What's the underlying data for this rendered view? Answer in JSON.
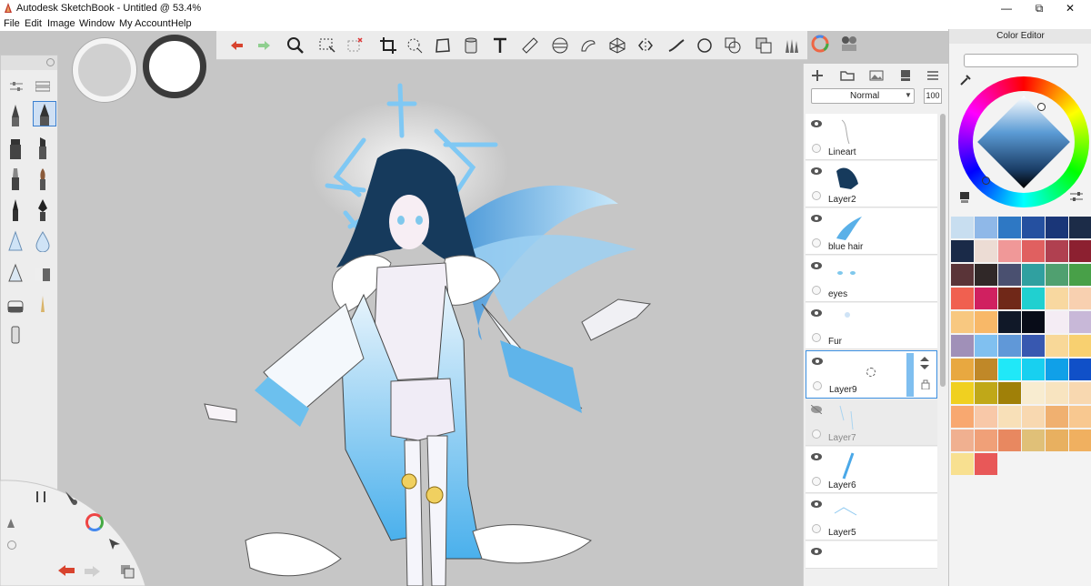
{
  "window": {
    "title": "Autodesk SketchBook - Untitled @ 53.4%",
    "minimize_glyph": "—",
    "restore_glyph": "⧉",
    "close_glyph": "✕"
  },
  "menu": [
    "File",
    "Edit",
    "Image",
    "Window",
    "My Account",
    "Help"
  ],
  "toolbar": {
    "icons": [
      "undo-icon",
      "redo-icon",
      "zoom-icon",
      "select-icon",
      "crop-select-icon",
      "crop-icon",
      "lasso-icon",
      "transform-icon",
      "fill-icon",
      "text-icon",
      "ruler-icon",
      "ellipse-guide-icon",
      "french-curve-icon",
      "perspective-icon",
      "symmetry-icon",
      "stroke-icon",
      "circle-icon",
      "shape-icon",
      "layers-editor-icon",
      "brush-library-icon",
      "color-wheel-icon",
      "copic-icon"
    ]
  },
  "layers_panel": {
    "blend_mode": "Normal",
    "opacity": "100",
    "layers": [
      {
        "name": "Lineart",
        "visible": true,
        "selected": false
      },
      {
        "name": "Layer2",
        "visible": true,
        "selected": false
      },
      {
        "name": "blue hair",
        "visible": true,
        "selected": false
      },
      {
        "name": "eyes",
        "visible": true,
        "selected": false
      },
      {
        "name": "Fur",
        "visible": true,
        "selected": false
      },
      {
        "name": "Layer9",
        "visible": true,
        "selected": true
      },
      {
        "name": "Layer7",
        "visible": false,
        "selected": false
      },
      {
        "name": "Layer6",
        "visible": true,
        "selected": false
      },
      {
        "name": "Layer5",
        "visible": true,
        "selected": false
      }
    ]
  },
  "color_editor": {
    "title": "Color Editor",
    "current_color": "#3d6d9c",
    "swatches": [
      "#c8def0",
      "#8fb8e8",
      "#2e78c4",
      "#2550a0",
      "#1a3678",
      "#1c2c48",
      "#1a2a48",
      "#ecdcd4",
      "#f09898",
      "#e06060",
      "#b04050",
      "#8c2030",
      "#5a3438",
      "#302828",
      "#4a5070",
      "#30a0a0",
      "#50a070",
      "#48a048",
      "#f06050",
      "#d02060",
      "#702818",
      "#20d0d0",
      "#f8d8a0",
      "#f8d0b0",
      "#f8c880",
      "#f8b868",
      "#101828",
      "#080c18",
      "#f4ecf4",
      "#c8b8d8",
      "#a090b8",
      "#80c0f0",
      "#6098d8",
      "#3858b0",
      "#f8d898",
      "#f8d070",
      "#e8a840",
      "#c08828",
      "#20e8f8",
      "#18d0f0",
      "#10a0e8",
      "#1050c8",
      "#f0d020",
      "#c0a818",
      "#a08008",
      "#f8ecd0",
      "#f8e4c0",
      "#f8d8b0",
      "#f8a870",
      "#f8c8a8",
      "#f8e0b8",
      "#f8d8b0",
      "#f0b070",
      "#f8c890",
      "#f0b090",
      "#f0a078",
      "#e88860",
      "#e0c078",
      "#e8b060",
      "#f0b060",
      "#f8e090",
      "#e85858"
    ]
  }
}
